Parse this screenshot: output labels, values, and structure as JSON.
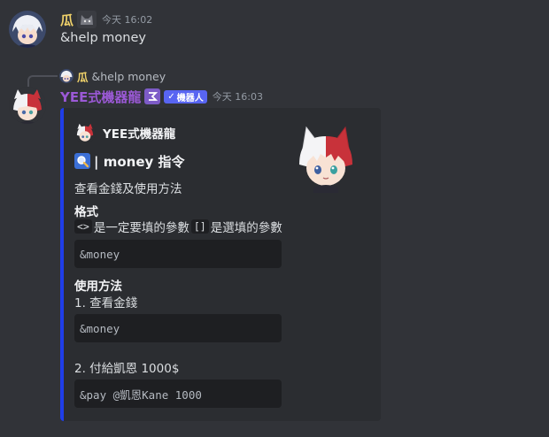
{
  "message1": {
    "username": "瓜",
    "timestamp": "今天 16:02",
    "content": "&help money"
  },
  "reply": {
    "username": "瓜",
    "content": "&help money"
  },
  "message2": {
    "username": "YEE式機器龍",
    "bot_tag": "機器人",
    "timestamp": "今天 16:03",
    "embed": {
      "accent_color": "#1f3ee8",
      "author": "YEE式機器龍",
      "title": "| money 指令",
      "title_icon": "magnifier-icon",
      "description": "查看金錢及使用方法",
      "fields": {
        "format": {
          "name": "格式",
          "line_part1": "是一定要填的參數",
          "code1": "<>",
          "code2": "[]",
          "line_part2": "是選填的參數",
          "code_block": "&money"
        },
        "usage": {
          "name": "使用方法",
          "step1": "1. 查看金錢",
          "code_block1": "&money",
          "step2": "2. 付給凱恩 1000$",
          "code_block2": "&pay @凱恩Kane 1000"
        }
      }
    }
  }
}
